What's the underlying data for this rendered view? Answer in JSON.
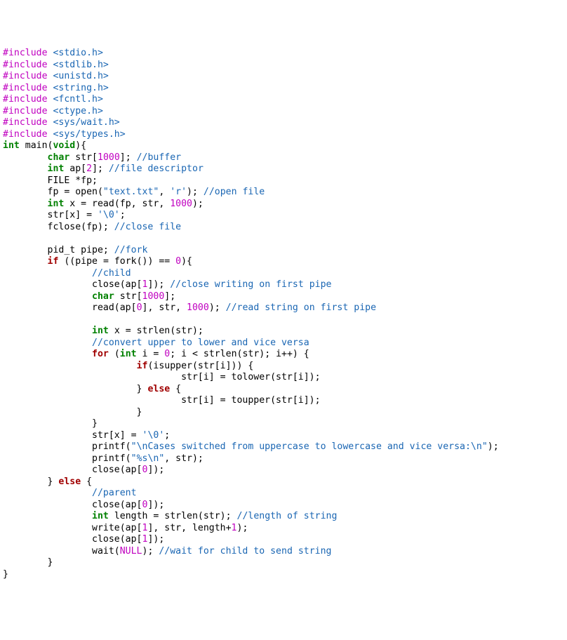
{
  "code": {
    "lines": [
      [
        {
          "c": "pp",
          "t": "#include "
        },
        {
          "c": "pp-inc",
          "t": "<stdio.h>"
        }
      ],
      [
        {
          "c": "pp",
          "t": "#include "
        },
        {
          "c": "pp-inc",
          "t": "<stdlib.h>"
        }
      ],
      [
        {
          "c": "pp",
          "t": "#include "
        },
        {
          "c": "pp-inc",
          "t": "<unistd.h>"
        }
      ],
      [
        {
          "c": "pp",
          "t": "#include "
        },
        {
          "c": "pp-inc",
          "t": "<string.h>"
        }
      ],
      [
        {
          "c": "pp",
          "t": "#include "
        },
        {
          "c": "pp-inc",
          "t": "<fcntl.h>"
        }
      ],
      [
        {
          "c": "pp",
          "t": "#include "
        },
        {
          "c": "pp-inc",
          "t": "<ctype.h>"
        }
      ],
      [
        {
          "c": "pp",
          "t": "#include "
        },
        {
          "c": "pp-inc",
          "t": "<sys/wait.h>"
        }
      ],
      [
        {
          "c": "pp",
          "t": "#include "
        },
        {
          "c": "pp-inc",
          "t": "<sys/types.h>"
        }
      ],
      [
        {
          "c": "kw-type",
          "t": "int"
        },
        {
          "c": "plain",
          "t": " main("
        },
        {
          "c": "kw-type",
          "t": "void"
        },
        {
          "c": "plain",
          "t": "){"
        }
      ],
      [
        {
          "c": "plain",
          "t": "        "
        },
        {
          "c": "kw-type",
          "t": "char"
        },
        {
          "c": "plain",
          "t": " str["
        },
        {
          "c": "num",
          "t": "1000"
        },
        {
          "c": "plain",
          "t": "]; "
        },
        {
          "c": "cmt",
          "t": "//buffer"
        }
      ],
      [
        {
          "c": "plain",
          "t": "        "
        },
        {
          "c": "kw-type",
          "t": "int"
        },
        {
          "c": "plain",
          "t": " ap["
        },
        {
          "c": "num",
          "t": "2"
        },
        {
          "c": "plain",
          "t": "]; "
        },
        {
          "c": "cmt",
          "t": "//file descriptor"
        }
      ],
      [
        {
          "c": "plain",
          "t": "        FILE *fp;"
        }
      ],
      [
        {
          "c": "plain",
          "t": "        fp = open("
        },
        {
          "c": "str",
          "t": "\"text.txt\""
        },
        {
          "c": "plain",
          "t": ", "
        },
        {
          "c": "chr",
          "t": "'r'"
        },
        {
          "c": "plain",
          "t": "); "
        },
        {
          "c": "cmt",
          "t": "//open file"
        }
      ],
      [
        {
          "c": "plain",
          "t": "        "
        },
        {
          "c": "kw-type",
          "t": "int"
        },
        {
          "c": "plain",
          "t": " x = read(fp, str, "
        },
        {
          "c": "num",
          "t": "1000"
        },
        {
          "c": "plain",
          "t": ");"
        }
      ],
      [
        {
          "c": "plain",
          "t": "        str[x] = "
        },
        {
          "c": "chr",
          "t": "'\\0'"
        },
        {
          "c": "plain",
          "t": ";"
        }
      ],
      [
        {
          "c": "plain",
          "t": "        fclose(fp); "
        },
        {
          "c": "cmt",
          "t": "//close file"
        }
      ],
      [
        {
          "c": "plain",
          "t": ""
        }
      ],
      [
        {
          "c": "plain",
          "t": "        pid_t pipe; "
        },
        {
          "c": "cmt",
          "t": "//fork"
        }
      ],
      [
        {
          "c": "plain",
          "t": "        "
        },
        {
          "c": "kw-ctrl",
          "t": "if"
        },
        {
          "c": "plain",
          "t": " ((pipe = fork()) == "
        },
        {
          "c": "num",
          "t": "0"
        },
        {
          "c": "plain",
          "t": "){"
        }
      ],
      [
        {
          "c": "plain",
          "t": "                "
        },
        {
          "c": "cmt",
          "t": "//child"
        }
      ],
      [
        {
          "c": "plain",
          "t": "                close(ap["
        },
        {
          "c": "num",
          "t": "1"
        },
        {
          "c": "plain",
          "t": "]); "
        },
        {
          "c": "cmt",
          "t": "//close writing on first pipe"
        }
      ],
      [
        {
          "c": "plain",
          "t": "                "
        },
        {
          "c": "kw-type",
          "t": "char"
        },
        {
          "c": "plain",
          "t": " str["
        },
        {
          "c": "num",
          "t": "1000"
        },
        {
          "c": "plain",
          "t": "];"
        }
      ],
      [
        {
          "c": "plain",
          "t": "                read(ap["
        },
        {
          "c": "num",
          "t": "0"
        },
        {
          "c": "plain",
          "t": "], str, "
        },
        {
          "c": "num",
          "t": "1000"
        },
        {
          "c": "plain",
          "t": "); "
        },
        {
          "c": "cmt",
          "t": "//read string on first pipe"
        }
      ],
      [
        {
          "c": "plain",
          "t": ""
        }
      ],
      [
        {
          "c": "plain",
          "t": "                "
        },
        {
          "c": "kw-type",
          "t": "int"
        },
        {
          "c": "plain",
          "t": " x = strlen(str);"
        }
      ],
      [
        {
          "c": "plain",
          "t": "                "
        },
        {
          "c": "cmt",
          "t": "//convert upper to lower and vice versa"
        }
      ],
      [
        {
          "c": "plain",
          "t": "                "
        },
        {
          "c": "kw-ctrl",
          "t": "for"
        },
        {
          "c": "plain",
          "t": " ("
        },
        {
          "c": "kw-type",
          "t": "int"
        },
        {
          "c": "plain",
          "t": " i = "
        },
        {
          "c": "num",
          "t": "0"
        },
        {
          "c": "plain",
          "t": "; i < strlen(str); i++) {"
        }
      ],
      [
        {
          "c": "plain",
          "t": "                        "
        },
        {
          "c": "kw-ctrl",
          "t": "if"
        },
        {
          "c": "plain",
          "t": "(isupper(str[i])) {"
        }
      ],
      [
        {
          "c": "plain",
          "t": "                                str[i] = tolower(str[i]);"
        }
      ],
      [
        {
          "c": "plain",
          "t": "                        } "
        },
        {
          "c": "kw-ctrl",
          "t": "else"
        },
        {
          "c": "plain",
          "t": " {"
        }
      ],
      [
        {
          "c": "plain",
          "t": "                                str[i] = toupper(str[i]);"
        }
      ],
      [
        {
          "c": "plain",
          "t": "                        }"
        }
      ],
      [
        {
          "c": "plain",
          "t": "                }"
        }
      ],
      [
        {
          "c": "plain",
          "t": "                str[x] = "
        },
        {
          "c": "chr",
          "t": "'\\0'"
        },
        {
          "c": "plain",
          "t": ";"
        }
      ],
      [
        {
          "c": "plain",
          "t": "                printf("
        },
        {
          "c": "str",
          "t": "\"\\nCases switched from uppercase to lowercase and vice versa:\\n\""
        },
        {
          "c": "plain",
          "t": ");"
        }
      ],
      [
        {
          "c": "plain",
          "t": "                printf("
        },
        {
          "c": "str",
          "t": "\"%s\\n\""
        },
        {
          "c": "plain",
          "t": ", str);"
        }
      ],
      [
        {
          "c": "plain",
          "t": "                close(ap["
        },
        {
          "c": "num",
          "t": "0"
        },
        {
          "c": "plain",
          "t": "]);"
        }
      ],
      [
        {
          "c": "plain",
          "t": "        } "
        },
        {
          "c": "kw-ctrl",
          "t": "else"
        },
        {
          "c": "plain",
          "t": " {"
        }
      ],
      [
        {
          "c": "plain",
          "t": "                "
        },
        {
          "c": "cmt",
          "t": "//parent"
        }
      ],
      [
        {
          "c": "plain",
          "t": "                close(ap["
        },
        {
          "c": "num",
          "t": "0"
        },
        {
          "c": "plain",
          "t": "]);"
        }
      ],
      [
        {
          "c": "plain",
          "t": "                "
        },
        {
          "c": "kw-type",
          "t": "int"
        },
        {
          "c": "plain",
          "t": " length = strlen(str); "
        },
        {
          "c": "cmt",
          "t": "//length of string"
        }
      ],
      [
        {
          "c": "plain",
          "t": "                write(ap["
        },
        {
          "c": "num",
          "t": "1"
        },
        {
          "c": "plain",
          "t": "], str, length+"
        },
        {
          "c": "num",
          "t": "1"
        },
        {
          "c": "plain",
          "t": ");"
        }
      ],
      [
        {
          "c": "plain",
          "t": "                close(ap["
        },
        {
          "c": "num",
          "t": "1"
        },
        {
          "c": "plain",
          "t": "]);"
        }
      ],
      [
        {
          "c": "plain",
          "t": "                wait("
        },
        {
          "c": "num",
          "t": "NULL"
        },
        {
          "c": "plain",
          "t": "); "
        },
        {
          "c": "cmt",
          "t": "//wait for child to send string"
        }
      ],
      [
        {
          "c": "plain",
          "t": "        }"
        }
      ],
      [
        {
          "c": "plain",
          "t": "}"
        }
      ]
    ]
  }
}
